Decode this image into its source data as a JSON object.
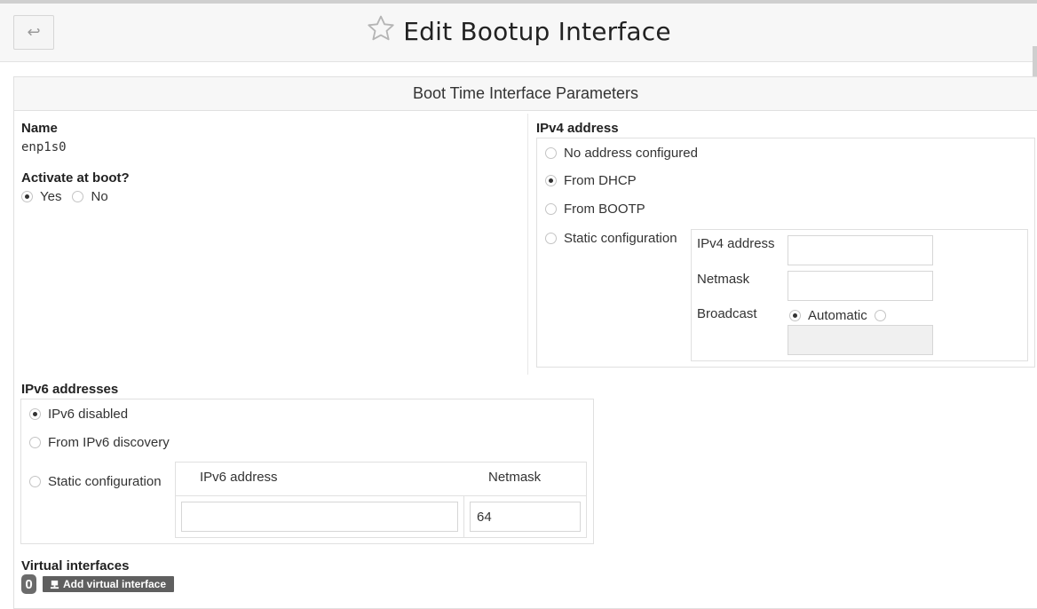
{
  "header": {
    "back_glyph": "↩",
    "title": "Edit Bootup Interface"
  },
  "panel": {
    "heading": "Boot Time Interface Parameters"
  },
  "name_field": {
    "label": "Name",
    "value": "enp1s0"
  },
  "activate": {
    "label": "Activate at boot?",
    "options": [
      {
        "label": "Yes",
        "checked": true
      },
      {
        "label": "No",
        "checked": false
      }
    ]
  },
  "ipv4": {
    "label": "IPv4 address",
    "options": [
      {
        "label": "No address configured",
        "checked": false
      },
      {
        "label": "From DHCP",
        "checked": true
      },
      {
        "label": "From BOOTP",
        "checked": false
      },
      {
        "label": "Static configuration",
        "checked": false
      }
    ],
    "static": {
      "address_label": "IPv4 address",
      "address_value": "",
      "netmask_label": "Netmask",
      "netmask_value": "",
      "broadcast_label": "Broadcast",
      "broadcast_auto_label": "Automatic",
      "broadcast_value": ""
    }
  },
  "ipv6": {
    "label": "IPv6 addresses",
    "options": [
      {
        "label": "IPv6 disabled",
        "checked": true
      },
      {
        "label": "From IPv6 discovery",
        "checked": false
      },
      {
        "label": "Static configuration",
        "checked": false
      }
    ],
    "table": {
      "col_address": "IPv6 address",
      "col_netmask": "Netmask",
      "address_value": "",
      "netmask_value": "64"
    }
  },
  "virtual": {
    "label": "Virtual interfaces",
    "count": "0",
    "add_label": "Add virtual interface"
  },
  "icons": {
    "back": "back-arrow-icon",
    "star": "star-outline-icon",
    "add": "network-add-icon"
  }
}
